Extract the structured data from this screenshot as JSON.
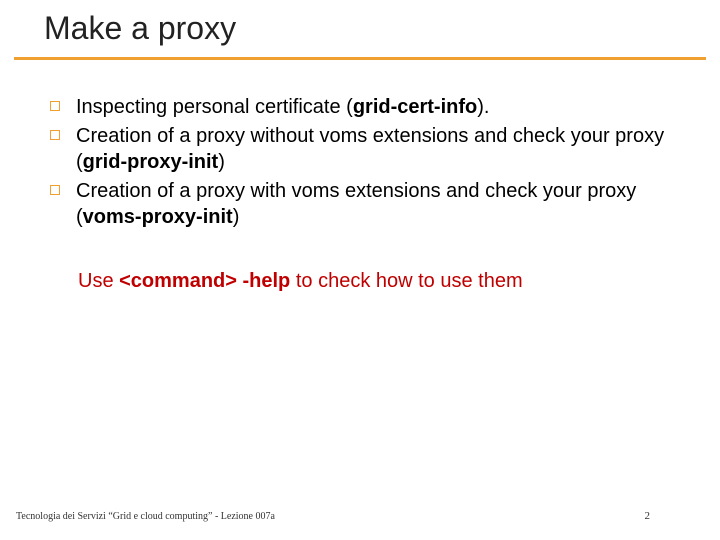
{
  "title": "Make a proxy",
  "bullets": [
    {
      "pre": "Inspecting personal certificate  (",
      "bold": "grid-cert-info",
      "post": ")."
    },
    {
      "pre": "Creation of a proxy without voms extensions  and check your proxy (",
      "bold": "grid-proxy-init",
      "post": ")"
    },
    {
      "pre": "Creation of a proxy with voms extensions  and check your proxy (",
      "bold": "voms-proxy-init",
      "post": ")"
    }
  ],
  "help": {
    "pre": "Use ",
    "bold": "<command> -help",
    "post": " to check how to use them"
  },
  "footer": {
    "left": "Tecnologia dei Servizi “Grid e cloud computing” - Lezione 007a",
    "right": "2"
  }
}
